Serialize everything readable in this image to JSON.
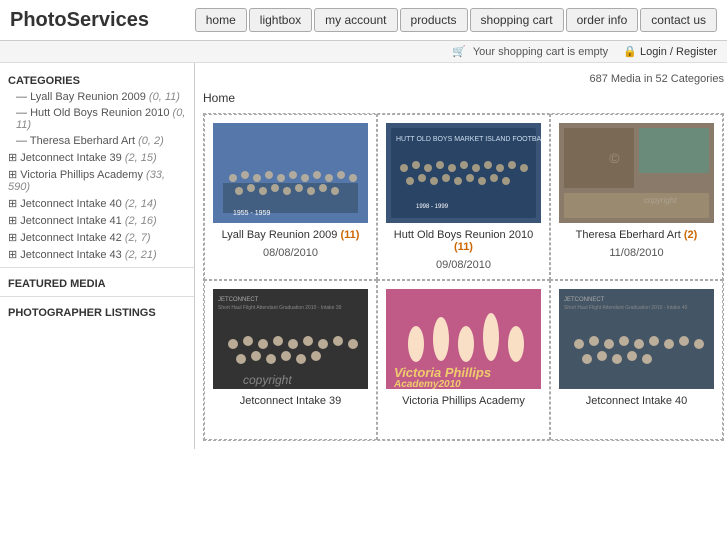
{
  "header": {
    "logo": "PhotoServices",
    "nav": [
      {
        "label": "home",
        "id": "home"
      },
      {
        "label": "lightbox",
        "id": "lightbox"
      },
      {
        "label": "my account",
        "id": "my-account"
      },
      {
        "label": "products",
        "id": "products"
      },
      {
        "label": "shopping cart",
        "id": "shopping-cart"
      },
      {
        "label": "order info",
        "id": "order-info"
      },
      {
        "label": "contact us",
        "id": "contact-us"
      }
    ]
  },
  "cart_bar": {
    "cart_text": "Your shopping cart is empty",
    "login_text": "Login / Register"
  },
  "stats": "687 Media in 52 Categories",
  "breadcrumb": "Home",
  "sidebar": {
    "categories_title": "CATEGORIES",
    "items": [
      {
        "label": "Lyall Bay Reunion 2009",
        "count": "(0, 11)",
        "indent": true,
        "plus": false
      },
      {
        "label": "Hutt Old Boys Reunion 2010",
        "count": "(0, 11)",
        "indent": true,
        "plus": false
      },
      {
        "label": "Theresa Eberhard Art",
        "count": "(0, 2)",
        "indent": true,
        "plus": false
      },
      {
        "label": "Jetconnect Intake 39",
        "count": "(2, 15)",
        "indent": false,
        "plus": true
      },
      {
        "label": "Victoria Phillips Academy",
        "count": "(33, 590)",
        "indent": false,
        "plus": true
      },
      {
        "label": "Jetconnect Intake 40",
        "count": "(2, 14)",
        "indent": false,
        "plus": true
      },
      {
        "label": "Jetconnect Intake 41",
        "count": "(2, 16)",
        "indent": false,
        "plus": true
      },
      {
        "label": "Jetconnect Intake 42",
        "count": "(2, 7)",
        "indent": false,
        "plus": true
      },
      {
        "label": "Jetconnect Intake 43",
        "count": "(2, 21)",
        "indent": false,
        "plus": true
      }
    ],
    "featured_media": "FEATURED MEDIA",
    "photographer_listings": "PHOTOGRAPHER LISTINGS"
  },
  "gallery": {
    "cells": [
      {
        "title": "Lyall Bay Reunion 2009",
        "count": "(11)",
        "date": "08/08/2010",
        "img_type": "lyall"
      },
      {
        "title": "Hutt Old Boys Reunion 2010",
        "count": "(11)",
        "date": "09/08/2010",
        "img_type": "hutt"
      },
      {
        "title": "Theresa Eberhard Art",
        "count": "(2)",
        "date": "11/08/2010",
        "img_type": "theresa"
      },
      {
        "title": "Jetconnect Intake 39",
        "count": "",
        "date": "",
        "img_type": "jetconn39"
      },
      {
        "title": "Victoria Phillips Academy",
        "count": "",
        "date": "",
        "img_type": "victoria"
      },
      {
        "title": "Jetconnect Intake 40",
        "count": "",
        "date": "",
        "img_type": "jetconn40"
      }
    ]
  }
}
